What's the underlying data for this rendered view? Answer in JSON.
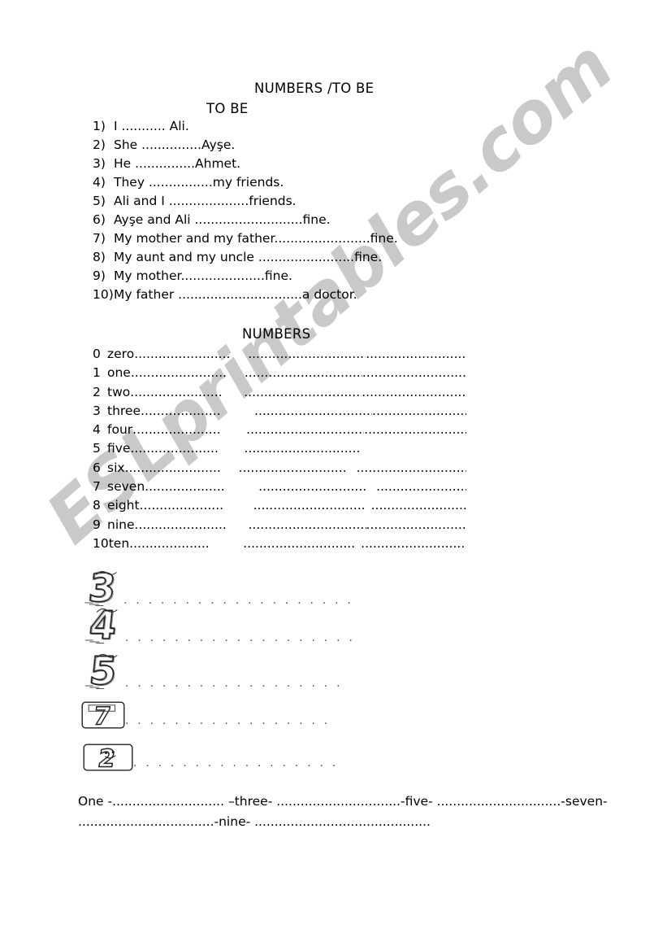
{
  "document": {
    "title_main": "NUMBERS /TO BE",
    "section_tobe_title": "TO BE",
    "section_numbers_title": "NUMBERS",
    "watermark": "ESLprintables.com",
    "watermark_color": "#c9c9c9"
  },
  "tobe": {
    "items": [
      {
        "num": "1)",
        "text": "I ........... Ali."
      },
      {
        "num": "2)",
        "text": "She ...............Ayşe."
      },
      {
        "num": "3)",
        "text": "He ...............Ahmet."
      },
      {
        "num": "4)",
        "text": "They ................my friends."
      },
      {
        "num": "5)",
        "text": "Ali and I ....................friends."
      },
      {
        "num": "6)",
        "text": "Ayşe and Ali ...........................fine."
      },
      {
        "num": "7)",
        "text": "My mother and my father........................fine."
      },
      {
        "num": "8)",
        "text": "My aunt and my uncle ........................fine."
      },
      {
        "num": "9)",
        "text": "My mother.....................fine."
      },
      {
        "num": "10)",
        "text": "My father ...............................a doctor."
      }
    ]
  },
  "numbers": {
    "rows": [
      {
        "digit": "0",
        "word": "zero",
        "col1": "........................",
        "col2": "...............................",
        "col3": "..............................."
      },
      {
        "digit": "1",
        "word": "one",
        "col1": "........................",
        "col2": "...............................",
        "col3": "................................"
      },
      {
        "digit": "2",
        "word": "two",
        "col1": ".......................",
        "col2": "...............................",
        "col3": "................................."
      },
      {
        "digit": "3",
        "word": "three",
        "col1": "....................",
        "col2": "..............................",
        "col3": ".................................."
      },
      {
        "digit": "4",
        "word": "four",
        "col1": "......................",
        "col2": "..............................",
        "col3": "................................."
      },
      {
        "digit": "5",
        "word": "five",
        "col1": "......................",
        "col2": ".........................................................."
      },
      {
        "digit": "6",
        "word": "six",
        "col1": "........................",
        "col2": "...........................",
        "col3": "............................."
      },
      {
        "digit": "7",
        "word": "seven",
        "col1": "....................",
        "col2": "...........................",
        "col3": ".............................."
      },
      {
        "digit": "8",
        "word": "eight",
        "col1": ".....................",
        "col2": "............................",
        "col3": "..............................."
      },
      {
        "digit": "9",
        "word": "nine",
        "col1": ".......................",
        "col2": "..............................",
        "col3": "............................"
      },
      {
        "digit": "10",
        "word": "ten",
        "col1": "....................",
        "col2": "............................",
        "col3": "............................."
      }
    ]
  },
  "digit_pictures": {
    "items": [
      {
        "digit": "3",
        "style": "sketch",
        "line": ". . . . . . . . . . . . . . . . . . ."
      },
      {
        "digit": "4",
        "style": "sketch",
        "line": ". . . . . . . . . . . . . . . . . . ."
      },
      {
        "digit": "5",
        "style": "sketch",
        "line": ". . . . . . . . . . . . . . . . . ."
      },
      {
        "digit": "7",
        "style": "boxed",
        "line": ". . . . . . . . . . . . . . . . ."
      },
      {
        "digit": "2",
        "style": "boxed-face",
        "line": ". . . . . . . . . . . . . . . . ."
      }
    ]
  },
  "sequence": {
    "line1": "One -............................ –three-  ...............................-five- ...............................-seven-",
    "line2": "..................................-nine- ............................................"
  }
}
